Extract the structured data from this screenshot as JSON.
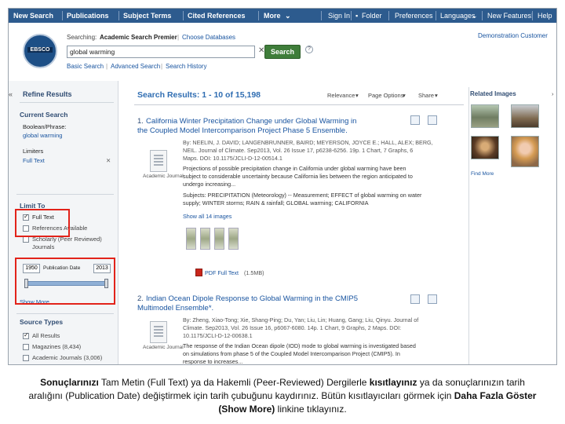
{
  "nav": {
    "left": [
      "New Search",
      "Publications",
      "Subject Terms",
      "Cited References",
      "More"
    ],
    "right": [
      "Sign In",
      "Folder",
      "Preferences",
      "Languages",
      "New Features!",
      "Help"
    ]
  },
  "header": {
    "logo_text": "EBSCO",
    "searching_label": "Searching:",
    "database": "Academic Search Premier",
    "choose_databases": "Choose Databases",
    "search_value": "global warming",
    "search_button": "Search",
    "links": [
      "Basic Search",
      "Advanced Search",
      "Search History"
    ],
    "customer": "Demonstration Customer"
  },
  "refine": {
    "title": "Refine Results",
    "current_search": "Current Search",
    "boolean_label": "Boolean/Phrase:",
    "boolean_value": "global warming",
    "limiters_label": "Limiters",
    "limiter_value": "Full Text",
    "limit_to": "Limit To",
    "limit_options": [
      "Full Text",
      "References Available",
      "Scholarly (Peer Reviewed)",
      "Journals"
    ],
    "year_from": "1950",
    "publication_date": "Publication Date",
    "year_to": "2013",
    "show_more": "Show More",
    "source_types": "Source Types",
    "source_options": [
      "All Results",
      "Magazines (8,434)",
      "Academic Journals (3,006)"
    ]
  },
  "results": {
    "header": "Search Results: 1 - 10 of 15,198",
    "controls": [
      "Relevance",
      "Page Options",
      "Share"
    ],
    "items": [
      {
        "number": "1.",
        "title_line1": "California Winter Precipitation Change under Global Warming in",
        "title_line2": "the Coupled Model Intercomparison Project Phase 5 Ensemble.",
        "meta1": "By: NEELIN, J. DAVID; LANGENBRUNNER, BAIRD; MEYERSON, JOYCE E.; HALL, ALEX; BERG,",
        "meta2": "NEIL. Journal of Climate. Sep2013, Vol. 26 Issue 17, p6238-6256. 19p. 1 Chart, 7 Graphs, 6",
        "meta3": "Maps. DOI: 10.1175/JCLI-D-12-00514.1",
        "abs1": "Projections of possible precipitation change in California under global warming have been",
        "abs2": "subject to considerable uncertainty because California lies between the region anticipated to",
        "abs3": "undergo increasing...",
        "subj1": "Subjects: PRECIPITATION (Meteorology) -- Measurement; EFFECT of global warming on water",
        "subj2": "supply; WINTER storms; RAIN & rainfall; GLOBAL warming; CALIFORNIA",
        "images_link": "Show all 14 images",
        "pdf": "PDF Full Text",
        "pdf_size": "(1.5MB)",
        "type_label": "Academic Journal"
      },
      {
        "number": "2.",
        "title_line1": "Indian Ocean Dipole Response to Global Warming in the CMIP5",
        "title_line2": "Multimodel Ensemble*.",
        "meta1": "By: Zheng, Xiao-Tong; Xie, Shang-Ping; Du, Yan; Liu, Lin; Huang, Gang; Liu, Qinyu. Journal of",
        "meta2": "Climate. Sep2013, Vol. 26 Issue 16, p6067-6080. 14p. 1 Chart, 9 Graphs, 2 Maps. DOI:",
        "meta3": "10.1175/JCLI-D-12-00638.1",
        "abs1": "The response of the Indian Ocean dipole (IOD) mode to global warming is investigated based",
        "abs2": "on simulations from phase 5 of the Coupled Model Intercomparison Project (CMIP5). In",
        "abs3": "response to increases...",
        "type_label": "Academic Journal"
      }
    ]
  },
  "related": {
    "title": "Related Images",
    "find_more": "Find More"
  },
  "caption": {
    "p1": "Sonuçlarınızı",
    "p2": " Tam Metin (Full Text) ya da Hakemli (Peer-Reviewed) Dergilerle ",
    "p3": "kısıtlayınız",
    "p4": " ya da sonuçlarınızın tarih aralığını (Publication Date) değiştirmek için tarih çubuğunu kaydırınız. Bütün kısıtlayıcıları görmek için ",
    "p5": "Daha Fazla Göster (Show More)",
    "p6": " linkine tıklayınız."
  }
}
